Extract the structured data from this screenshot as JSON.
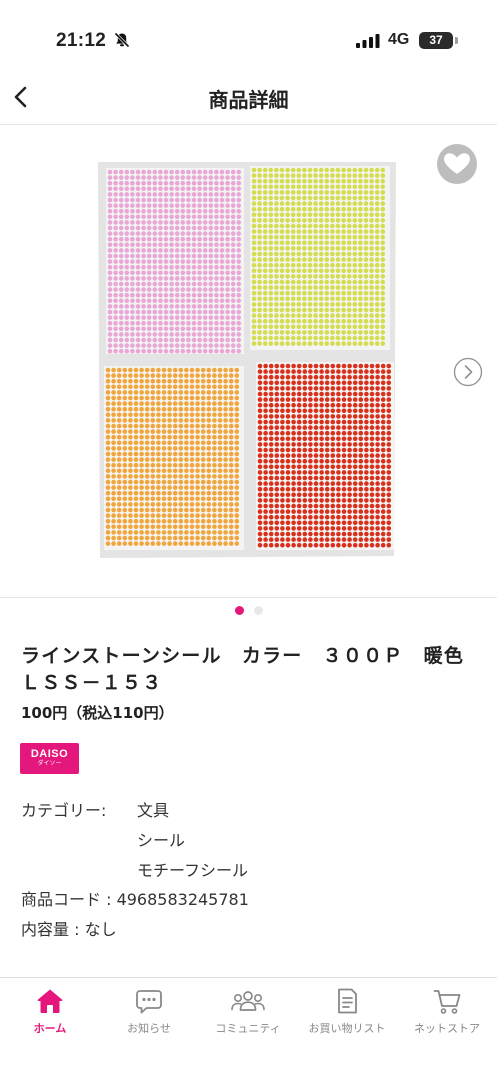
{
  "status_bar": {
    "time": "21:12",
    "network": "4G",
    "battery": "37"
  },
  "header": {
    "title": "商品詳細"
  },
  "gallery": {
    "image_count": 2,
    "active_index": 0,
    "sheet_colors": [
      "#e9a7d6",
      "#d3dd4f",
      "#f1a63b",
      "#d9301b"
    ]
  },
  "product": {
    "name": "ラインストーンシール　カラー　３００Ｐ　暖色ＬＳＳ－１５３",
    "price": "100円（税込110円）",
    "brand": {
      "main": "DAISO",
      "sub": "ダイソー"
    },
    "category_label": "カテゴリー:",
    "categories": [
      "文具",
      "シール",
      "モチーフシール"
    ],
    "code": "商品コード : 4968583245781",
    "volume": "内容量 : なし"
  },
  "tab_bar": {
    "tabs": [
      {
        "label": "ホーム",
        "icon": "home-icon",
        "active": true
      },
      {
        "label": "お知らせ",
        "icon": "chat-bubble-icon",
        "active": false
      },
      {
        "label": "コミュニティ",
        "icon": "people-icon",
        "active": false
      },
      {
        "label": "お買い物リスト",
        "icon": "list-icon",
        "active": false
      },
      {
        "label": "ネットストア",
        "icon": "cart-icon",
        "active": false
      }
    ]
  },
  "colors": {
    "accent": "#e4177c"
  }
}
